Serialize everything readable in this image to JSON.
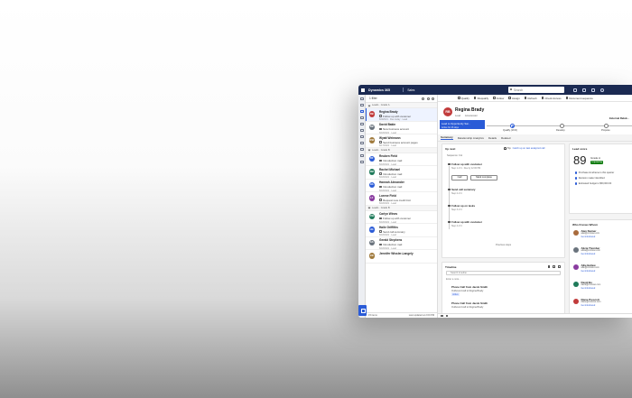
{
  "app": {
    "title": "Dynamics 365",
    "area": "Sales"
  },
  "search": {
    "placeholder": "Search"
  },
  "list": {
    "filter_label": "1 filter",
    "groups": [
      "Leads · Grade A",
      "Leads · Grade B",
      "Leads · Grade B"
    ],
    "leads": [
      {
        "name": "Regina Brady",
        "activity": "Follow up with customer",
        "date": "6/9/2021 · Due today · Lead",
        "color": "#c13b3b",
        "initials": "RB",
        "selected": true
      },
      {
        "name": "David Bakin",
        "activity": "New business account",
        "date": "6/18/2021 · Lead",
        "color": "#6a737d",
        "initials": "DB"
      },
      {
        "name": "Wyatt Weimann",
        "activity": "Send business account pages",
        "date": "6/17/2021 · Lead",
        "color": "#a07a3c",
        "initials": "WW"
      },
      {
        "name": "Reuben Field",
        "activity": "Introduction mail",
        "date": "6/18/2021 · Lead",
        "color": "#2a5bd7",
        "initials": "RF"
      },
      {
        "name": "Rachel Michael",
        "activity": "Introduction mail",
        "date": "6/18/2021 · Lead",
        "color": "#1f7a5a",
        "initials": "RM"
      },
      {
        "name": "Hannah Alexander",
        "activity": "Introduction mail",
        "date": "6/18/2021 · Lead",
        "color": "#2a5bd7",
        "initials": "HA"
      },
      {
        "name": "Lorene Field",
        "activity": "Request new credit limit",
        "date": "6/18/2021 · Lead",
        "color": "#8a3ca0",
        "initials": "LF"
      },
      {
        "name": "Carlyn Wines",
        "activity": "Follow up with customer",
        "date": "6/18/2021 · Lead",
        "color": "#1f7a5a",
        "initials": "CW"
      },
      {
        "name": "Haile Griffiths",
        "activity": "Send call summary",
        "date": "6/18/2021 · Lead",
        "color": "#2a5bd7",
        "initials": "HG"
      },
      {
        "name": "Gerald Stephens",
        "activity": "Introduction mail",
        "date": "6/18/2021 · Lead",
        "color": "#6a737d",
        "initials": "GS"
      },
      {
        "name": "Jennifer Wissler-Langely",
        "activity": "",
        "date": "",
        "color": "#a07a3c",
        "initials": "JW"
      }
    ],
    "footer_count": "15 items",
    "footer_updated": "Last updated at 2:00 PM"
  },
  "commands": [
    "Qualify",
    "Disqualify",
    "Follow",
    "Assign",
    "Refresh",
    "Check Access",
    "Document sequence"
  ],
  "record": {
    "initials": "RB",
    "name": "Regina Brady",
    "type": "Lead",
    "subtype": "Accelerator",
    "stage_title": "Lead to Opportunity Sal...",
    "stage_sub": "Active for 26 days",
    "stages": [
      "Qualify (19 D)",
      "Develop",
      "Propose"
    ],
    "external_label": "External Relati..."
  },
  "tabs": [
    "Summary",
    "Relationship Analytics",
    "Details",
    "Related"
  ],
  "upnext": {
    "title": "Up next",
    "tip": "Tip:",
    "tip_link": "Catch up on last analyzed call",
    "sequence": "Sequence: Col",
    "steps": [
      {
        "name": "Follow up with customer",
        "desc": "Step 1 of 4 · Due by 12:00 PM"
      },
      {
        "name": "Send call summary",
        "desc": "Step 2 of 4"
      },
      {
        "name": "Follow up on tasks",
        "desc": "Step 3 of 4"
      },
      {
        "name": "Follow up with customer",
        "desc": "Step 4 of 4"
      }
    ],
    "call_label": "Call",
    "template_label": "Mark complete",
    "previous_label": "Previous steps"
  },
  "timeline": {
    "title": "Timeline",
    "search_placeholder": "Search timeline",
    "note_placeholder": "Enter a note...",
    "items": [
      {
        "name": "Phone Call from Jacob Smith",
        "desc": "Outbound call to Regina Brady",
        "tag": "Active"
      },
      {
        "name": "Phone Call from Jacob Smith",
        "desc": "Outbound call to Regina Brady",
        "tag": ""
      }
    ]
  },
  "lead_score": {
    "title": "Lead score",
    "score": "89",
    "grade": "Grade A",
    "trend": "Improving",
    "factors": [
      "Purchase timeframe is this quarter",
      "Decision maker identified",
      "Estimated budget is $50,000.00"
    ]
  },
  "who_knows": {
    "title": "Who Knows Whom",
    "people": [
      {
        "name": "Alan Steiner",
        "email": "alan@contoso.com",
        "link": "Get introduced",
        "color": "#a86b3c"
      },
      {
        "name": "Alicia Thomber",
        "email": "alicia@contoso.com",
        "link": "Get introduced",
        "color": "#6a737d"
      },
      {
        "name": "Allie Bellew",
        "email": "allie@contoso.com",
        "link": "Get introduced",
        "color": "#8a3ca0"
      },
      {
        "name": "David Bo",
        "email": "david@contoso.com",
        "link": "Get introduced",
        "color": "#1f7a5a"
      },
      {
        "name": "Diane Prescott",
        "email": "diane@contoso.com",
        "link": "Get introduced",
        "color": "#c13b3b"
      }
    ]
  },
  "colors": {
    "navy": "#1b2a52",
    "accent": "#2a5bd7",
    "lead_avatar": "#c13b3b",
    "improving": "#107c10"
  }
}
